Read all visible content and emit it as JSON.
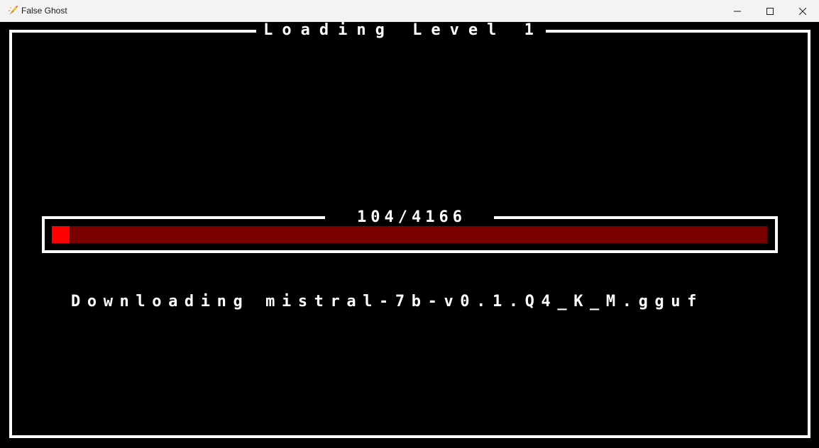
{
  "window": {
    "title": "False Ghost",
    "controls": {
      "minimize": "minimize-icon",
      "maximize": "maximize-icon",
      "close": "close-icon"
    }
  },
  "loading": {
    "title": "Loading Level 1",
    "progress_label": "104/4166",
    "progress_current": 104,
    "progress_total": 4166,
    "status": "Downloading mistral-7b-v0.1.Q4_K_M.gguf"
  },
  "colors": {
    "background": "#000000",
    "frame": "#ffffff",
    "progress_track": "#7a0000",
    "progress_fill": "#ff0000"
  }
}
